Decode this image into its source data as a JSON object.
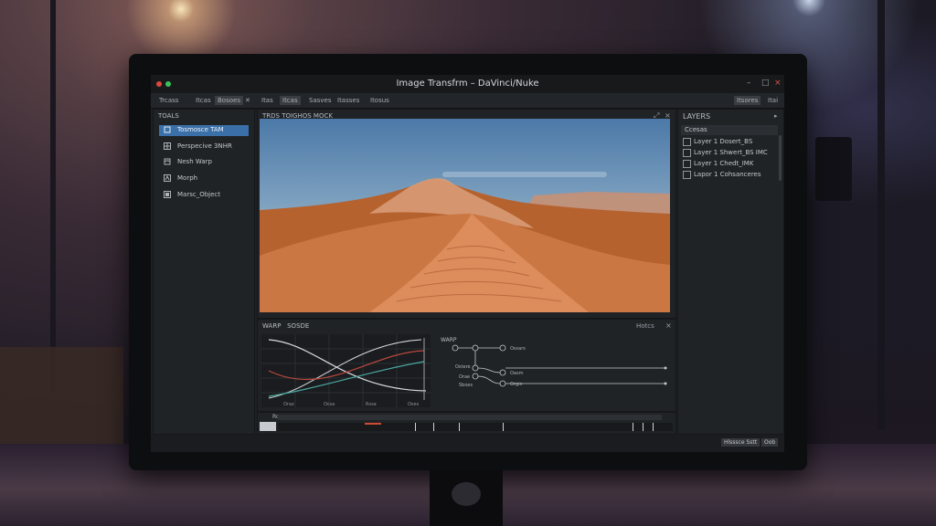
{
  "window": {
    "title": "Image Transfrm – DaVinci/Nuke",
    "controls": {
      "minimize": "–",
      "maximize": "□",
      "close": "×"
    }
  },
  "menubar": {
    "left_items": [
      "Trcass",
      "Itcas",
      "Bosoes"
    ],
    "mid_items": [
      "Itas",
      "Itcas",
      "Sasves",
      "Itasses",
      "Itosus"
    ],
    "close_glyph": "✕",
    "right_items": [
      "Itsores",
      "Itai"
    ]
  },
  "tools_panel": {
    "header": "TOALS",
    "items": [
      {
        "icon": "transform-icon",
        "label": "Tosmosce TAM",
        "selected": true
      },
      {
        "icon": "perspective-icon",
        "label": "Perspecive 3NHR",
        "selected": false
      },
      {
        "icon": "mesh-warp-icon",
        "label": "Nesh Warp",
        "selected": false
      },
      {
        "icon": "morph-icon",
        "label": "Morph",
        "selected": false
      },
      {
        "icon": "object-icon",
        "label": "Marsc_Object",
        "selected": false
      }
    ]
  },
  "viewer": {
    "header": "TRDS  TOIGHOS MOCK",
    "controls": [
      "⤢",
      "×"
    ]
  },
  "layers_panel": {
    "header": "LAYERS",
    "subheader": "Ccesas",
    "items": [
      {
        "icon": "layer-icon",
        "label": "Layer 1 Dosert_BS"
      },
      {
        "icon": "layer-icon",
        "label": "Layer 1 Shwert_BS IMC"
      },
      {
        "icon": "layer-icon",
        "label": "Layer 1 Chedt_IMK"
      },
      {
        "icon": "layer-icon",
        "label": "Lapor 1 Cohsanceres"
      }
    ]
  },
  "curves_panel": {
    "header_a": "WARP",
    "header_b": "SOSDE",
    "x_ticks": [
      "Oraz",
      "Ocsa",
      "Rssa",
      "Oses"
    ],
    "colors": {
      "white": "#d8dadd",
      "red": "#b8483e",
      "teal": "#4aa8a0"
    }
  },
  "nodes_panel": {
    "title": "WARP",
    "labels": [
      "Ossars",
      "Ostere",
      "Oasm",
      "Orae",
      "Sboes",
      "Orgis"
    ],
    "top_controls": [
      "Hotcs",
      "×"
    ]
  },
  "timeline": {
    "label": "Ro",
    "marker_color": "#d24a32"
  },
  "statusbar": {
    "buttons": [
      "Hlsssce Sstt",
      "Oob"
    ]
  },
  "colors": {
    "accent": "#3a6fa8",
    "panel": "#202326",
    "window_dot_red": "#e0463b",
    "window_dot_green": "#3cc25a"
  }
}
